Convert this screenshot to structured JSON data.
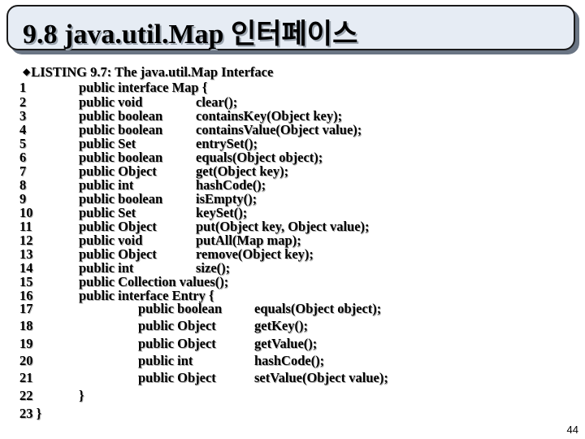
{
  "title": "9.8 java.util.Map 인터페이스",
  "listing": {
    "bullet": "u",
    "heading": "LISTING 9.7: The java.util.Map Interface"
  },
  "code_lines": [
    {
      "num": "1",
      "a": "public interface Map {",
      "b": "",
      "c": ""
    },
    {
      "num": "2",
      "a": "public void",
      "b": "clear();",
      "c": ""
    },
    {
      "num": "3",
      "a": "public boolean",
      "b": "containsKey(Object key);",
      "c": ""
    },
    {
      "num": "4",
      "a": "public boolean",
      "b": "containsValue(Object value);",
      "c": ""
    },
    {
      "num": "5",
      "a": "public Set",
      "b": "entrySet();",
      "c": ""
    },
    {
      "num": "6",
      "a": "public boolean",
      "b": "equals(Object object);",
      "c": ""
    },
    {
      "num": "7",
      "a": "public Object",
      "b": "get(Object key);",
      "c": ""
    },
    {
      "num": "8",
      "a": "public int",
      "b": "hashCode();",
      "c": ""
    },
    {
      "num": "9",
      "a": "public boolean",
      "b": "isEmpty();",
      "c": ""
    },
    {
      "num": "10",
      "a": "public Set",
      "b": "keySet();",
      "c": ""
    },
    {
      "num": "11",
      "a": "public Object",
      "b": "put(Object key, Object value);",
      "c": ""
    },
    {
      "num": "12",
      "a": "public void",
      "b": "putAll(Map map);",
      "c": ""
    },
    {
      "num": "13",
      "a": "public Object",
      "b": "remove(Object key);",
      "c": ""
    },
    {
      "num": "14",
      "a": "public int",
      "b": "size();",
      "c": ""
    },
    {
      "num": "15",
      "a": "public Collection values();",
      "b": "",
      "c": ""
    },
    {
      "num": "16",
      "a": "public interface Entry {",
      "b": "",
      "c": ""
    },
    {
      "num": "17",
      "a": "",
      "b": "public boolean",
      "c": "equals(Object object);"
    },
    {
      "num": "18",
      "a": "",
      "b": "public Object",
      "c": "getKey();"
    },
    {
      "num": "19",
      "a": "",
      "b": "public Object",
      "c": "getValue();"
    },
    {
      "num": "20",
      "a": "",
      "b": "public int",
      "c": "hashCode();"
    },
    {
      "num": "21",
      "a": "",
      "b": "public Object",
      "c": "setValue(Object value);"
    },
    {
      "num": "22",
      "a": "}",
      "b": "",
      "c": ""
    },
    {
      "num": "23 }",
      "a": "",
      "b": "",
      "c": ""
    }
  ],
  "page_number": "44"
}
